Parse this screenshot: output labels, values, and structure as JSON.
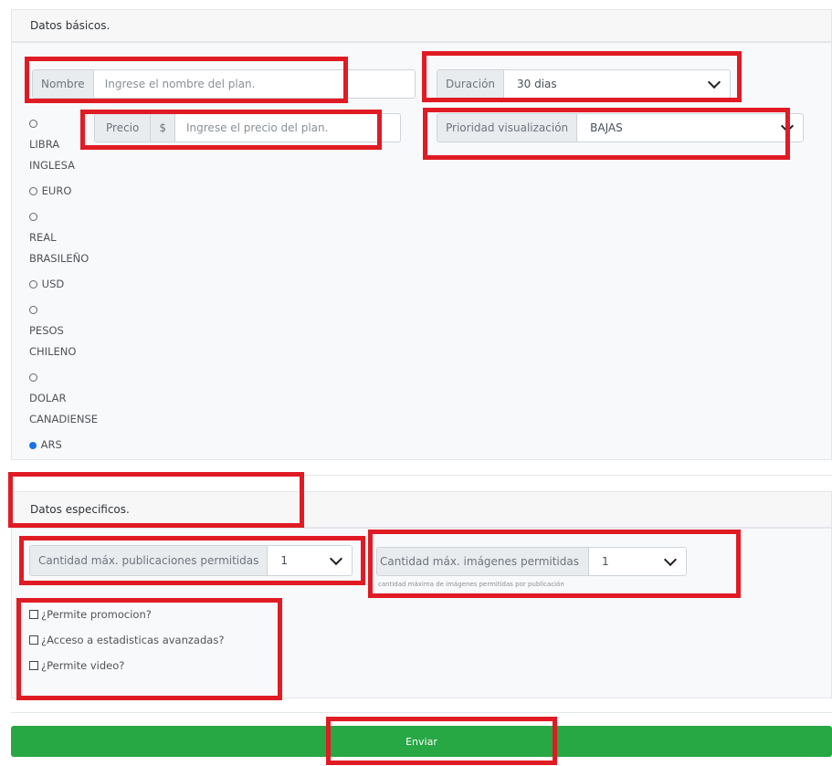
{
  "basic": {
    "header": "Datos básicos.",
    "nombre_label": "Nombre",
    "nombre_placeholder": "Ingrese el nombre del plan.",
    "duracion_label": "Duración",
    "duracion_value": "30 dias",
    "precio_label": "Precio",
    "precio_symbol": "$",
    "precio_placeholder": "Ingrese el precio del plan.",
    "prioridad_label": "Prioridad visualización",
    "prioridad_value": "BAJAS",
    "currencies": [
      {
        "lines": [
          "LIBRA",
          "INGLESA"
        ],
        "checked": false
      },
      {
        "lines": [
          "EURO"
        ],
        "checked": false
      },
      {
        "lines": [
          "REAL",
          "BRASILEÑO"
        ],
        "checked": false
      },
      {
        "lines": [
          "USD"
        ],
        "checked": false
      },
      {
        "lines": [
          "PESOS",
          "CHILENO"
        ],
        "checked": false
      },
      {
        "lines": [
          "DOLAR",
          "CANADIENSE"
        ],
        "checked": false
      },
      {
        "lines": [
          "ARS"
        ],
        "checked": true
      }
    ]
  },
  "specific": {
    "header": "Datos especificos.",
    "pub_label": "Cantidad máx. publicaciones permitidas",
    "pub_value": "1",
    "img_label": "Cantidad máx. imágenes permitidas",
    "img_value": "1",
    "img_help": "cantidad máxima de imágenes permitidas por publicación",
    "checks": [
      "¿Permite promocion?",
      "¿Acceso a estadisticas avanzadas?",
      "¿Permite video?"
    ]
  },
  "submit_label": "Enviar"
}
